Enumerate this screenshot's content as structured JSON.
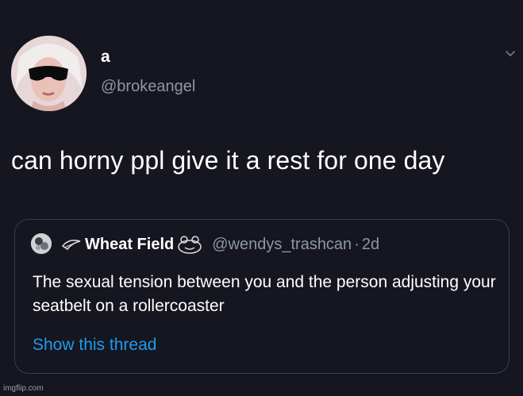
{
  "tweet": {
    "display_name": "a",
    "handle": "@brokeangel",
    "text": "can horny ppl give it a rest for one day"
  },
  "quote": {
    "name": "Wheat Field",
    "handle": "@wendys_trashcan",
    "separator": "·",
    "time": "2d",
    "text": "The sexual tension between you and the person adjusting your seatbelt on a rollercoaster",
    "show_thread_label": "Show this thread"
  },
  "watermark": "imgflip.com",
  "icons": {
    "more": "chevron-down-icon",
    "prefix": "leaf-emoji-icon",
    "suffix": "frog-emoji-icon"
  },
  "colors": {
    "background": "#15161f",
    "primary_text": "#ffffff",
    "secondary_text": "#8b98a5",
    "link": "#1d9bf0",
    "border": "#3a3d4a"
  }
}
